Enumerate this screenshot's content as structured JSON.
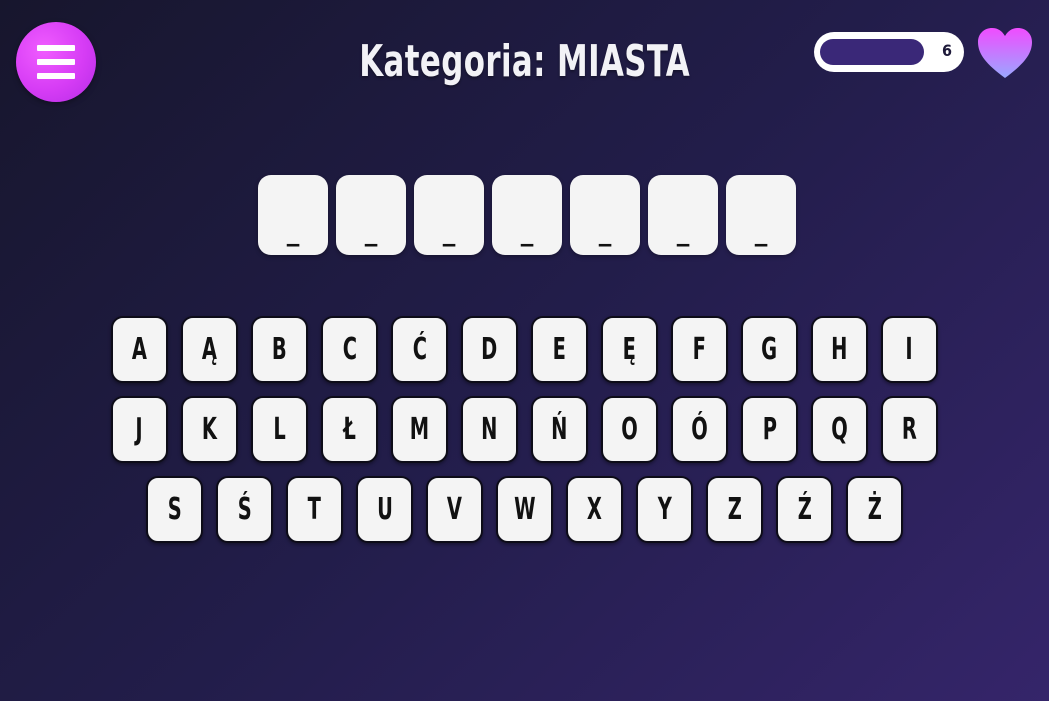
{
  "header": {
    "menu_icon": "hamburger-icon",
    "title": "Kategoria: MIASTA",
    "lives_count": "6",
    "lives_fraction": 0.72,
    "heart_icon": "heart-icon",
    "colors": {
      "menu_button": "#d63cf5",
      "progress_fill": "#3a2878",
      "heart_top": "#f04cff",
      "heart_bottom": "#9aa8ff"
    }
  },
  "word": {
    "slots": [
      "_",
      "_",
      "_",
      "_",
      "_",
      "_",
      "_"
    ]
  },
  "keyboard": {
    "rows": [
      [
        "A",
        "Ą",
        "B",
        "C",
        "Ć",
        "D",
        "E",
        "Ę",
        "F",
        "G",
        "H",
        "I"
      ],
      [
        "J",
        "K",
        "L",
        "Ł",
        "M",
        "N",
        "Ń",
        "O",
        "Ó",
        "P",
        "Q",
        "R"
      ],
      [
        "S",
        "Ś",
        "T",
        "U",
        "V",
        "W",
        "X",
        "Y",
        "Z",
        "Ź",
        "Ż"
      ]
    ]
  }
}
